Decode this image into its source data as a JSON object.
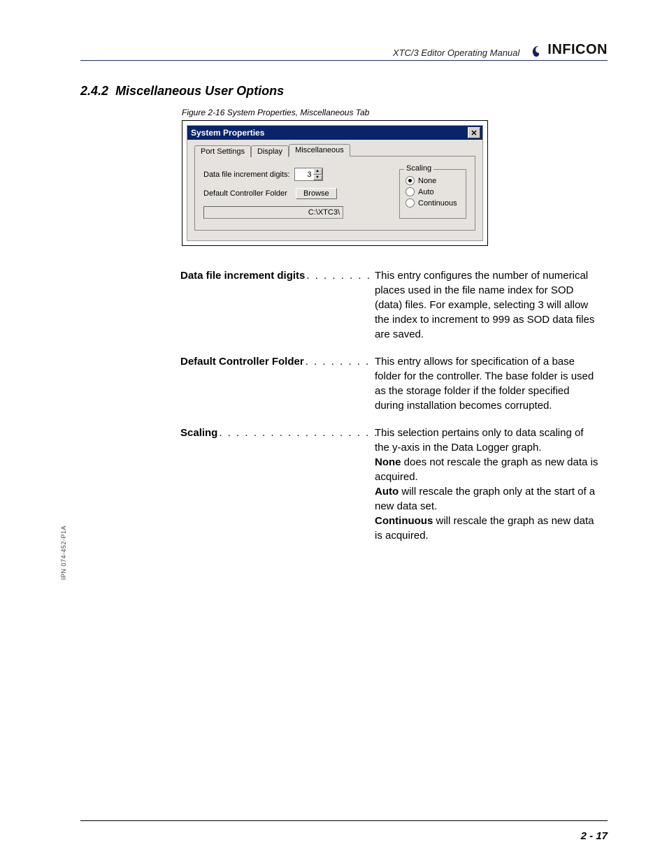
{
  "header": {
    "manual_title": "XTC/3 Editor Operating Manual",
    "brand": "INFICON"
  },
  "section": {
    "number": "2.4.2",
    "title": "Miscellaneous User Options"
  },
  "figure": {
    "caption": "Figure 2-16  System Properties, Miscellaneous Tab"
  },
  "dialog": {
    "title": "System Properties",
    "close_glyph": "✕",
    "tabs": [
      "Port Settings",
      "Display",
      "Miscellaneous"
    ],
    "active_tab_index": 2,
    "increment_label": "Data file increment digits:",
    "increment_value": "3",
    "folder_label": "Default Controller Folder",
    "browse_label": "Browse",
    "folder_path": "C:\\XTC3\\",
    "scaling": {
      "legend": "Scaling",
      "options": [
        "None",
        "Auto",
        "Continuous"
      ],
      "selected_index": 0
    }
  },
  "definitions": [
    {
      "term": "Data file increment digits",
      "dots": ". . . . . . . .",
      "body_html": "This entry configures the number of numerical places used in the file name index for SOD (data) files. For example, selecting 3 will allow the index to increment to 999 as SOD data files are saved."
    },
    {
      "term": "Default Controller Folder",
      "dots": ". . . . . . . .",
      "body_html": "This entry allows for specification of a base folder for the controller. The base folder is used as the storage folder if the folder specified during installation becomes corrupted."
    },
    {
      "term": "Scaling",
      "dots": ". . . . . . . . . . . . . . . . . . . . . . .",
      "body_html": "This selection pertains only to data scaling of the y-axis in the Data Logger graph.<br><b>None</b> does not rescale the graph as new data is acquired.<br><b>Auto</b> will rescale the graph only at the start of a new data set.<br><b>Continuous</b> will rescale the graph as new data is acquired."
    }
  ],
  "side_text": "IPN 074-452-P1A",
  "page_number": "2 - 17"
}
